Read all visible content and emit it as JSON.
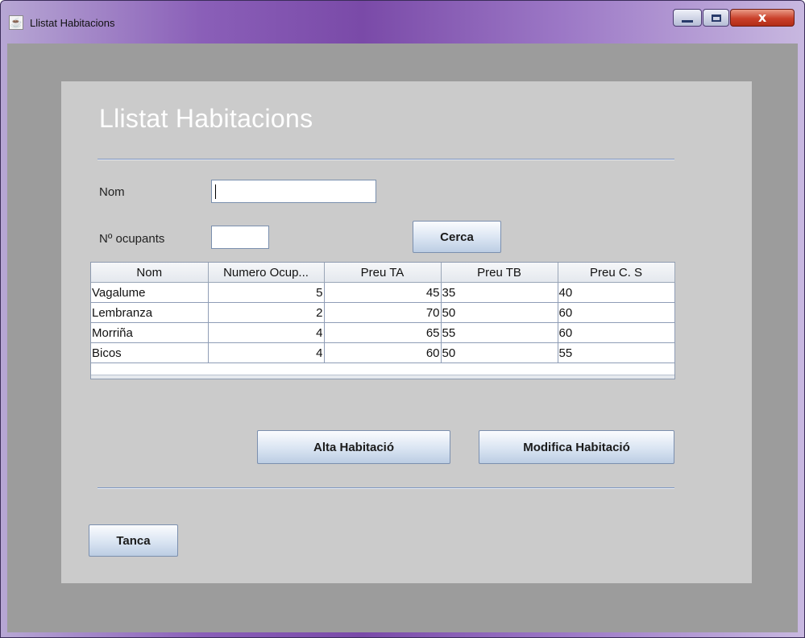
{
  "window": {
    "title": "Llistat Habitacions",
    "icon": "java-cup-icon",
    "controls": {
      "minimize": "minimize-icon",
      "maximize": "maximize-icon",
      "close": "x"
    }
  },
  "heading": "Llistat Habitacions",
  "form": {
    "nom_label": "Nom",
    "nom_value": "",
    "ocupants_label": "Nº ocupants",
    "ocupants_value": "",
    "search_button": "Cerca"
  },
  "table": {
    "columns": [
      "Nom",
      "Numero Ocup...",
      "Preu TA",
      "Preu TB",
      "Preu C. S"
    ],
    "rows": [
      [
        "Vagalume",
        "5",
        "45",
        "35",
        "40"
      ],
      [
        "Lembranza",
        "2",
        "70",
        "50",
        "60"
      ],
      [
        "Morriña",
        "4",
        "65",
        "55",
        "60"
      ],
      [
        "Bicos",
        "4",
        "60",
        "50",
        "55"
      ]
    ]
  },
  "actions": {
    "add_room": "Alta Habitació",
    "modify_room": "Modifica Habitació",
    "close": "Tanca"
  },
  "colors": {
    "panel_bg": "#cbcbcb",
    "client_bg": "#9c9c9c",
    "separator": "#7f97c2",
    "title_gradient": "#7a4aa8"
  }
}
